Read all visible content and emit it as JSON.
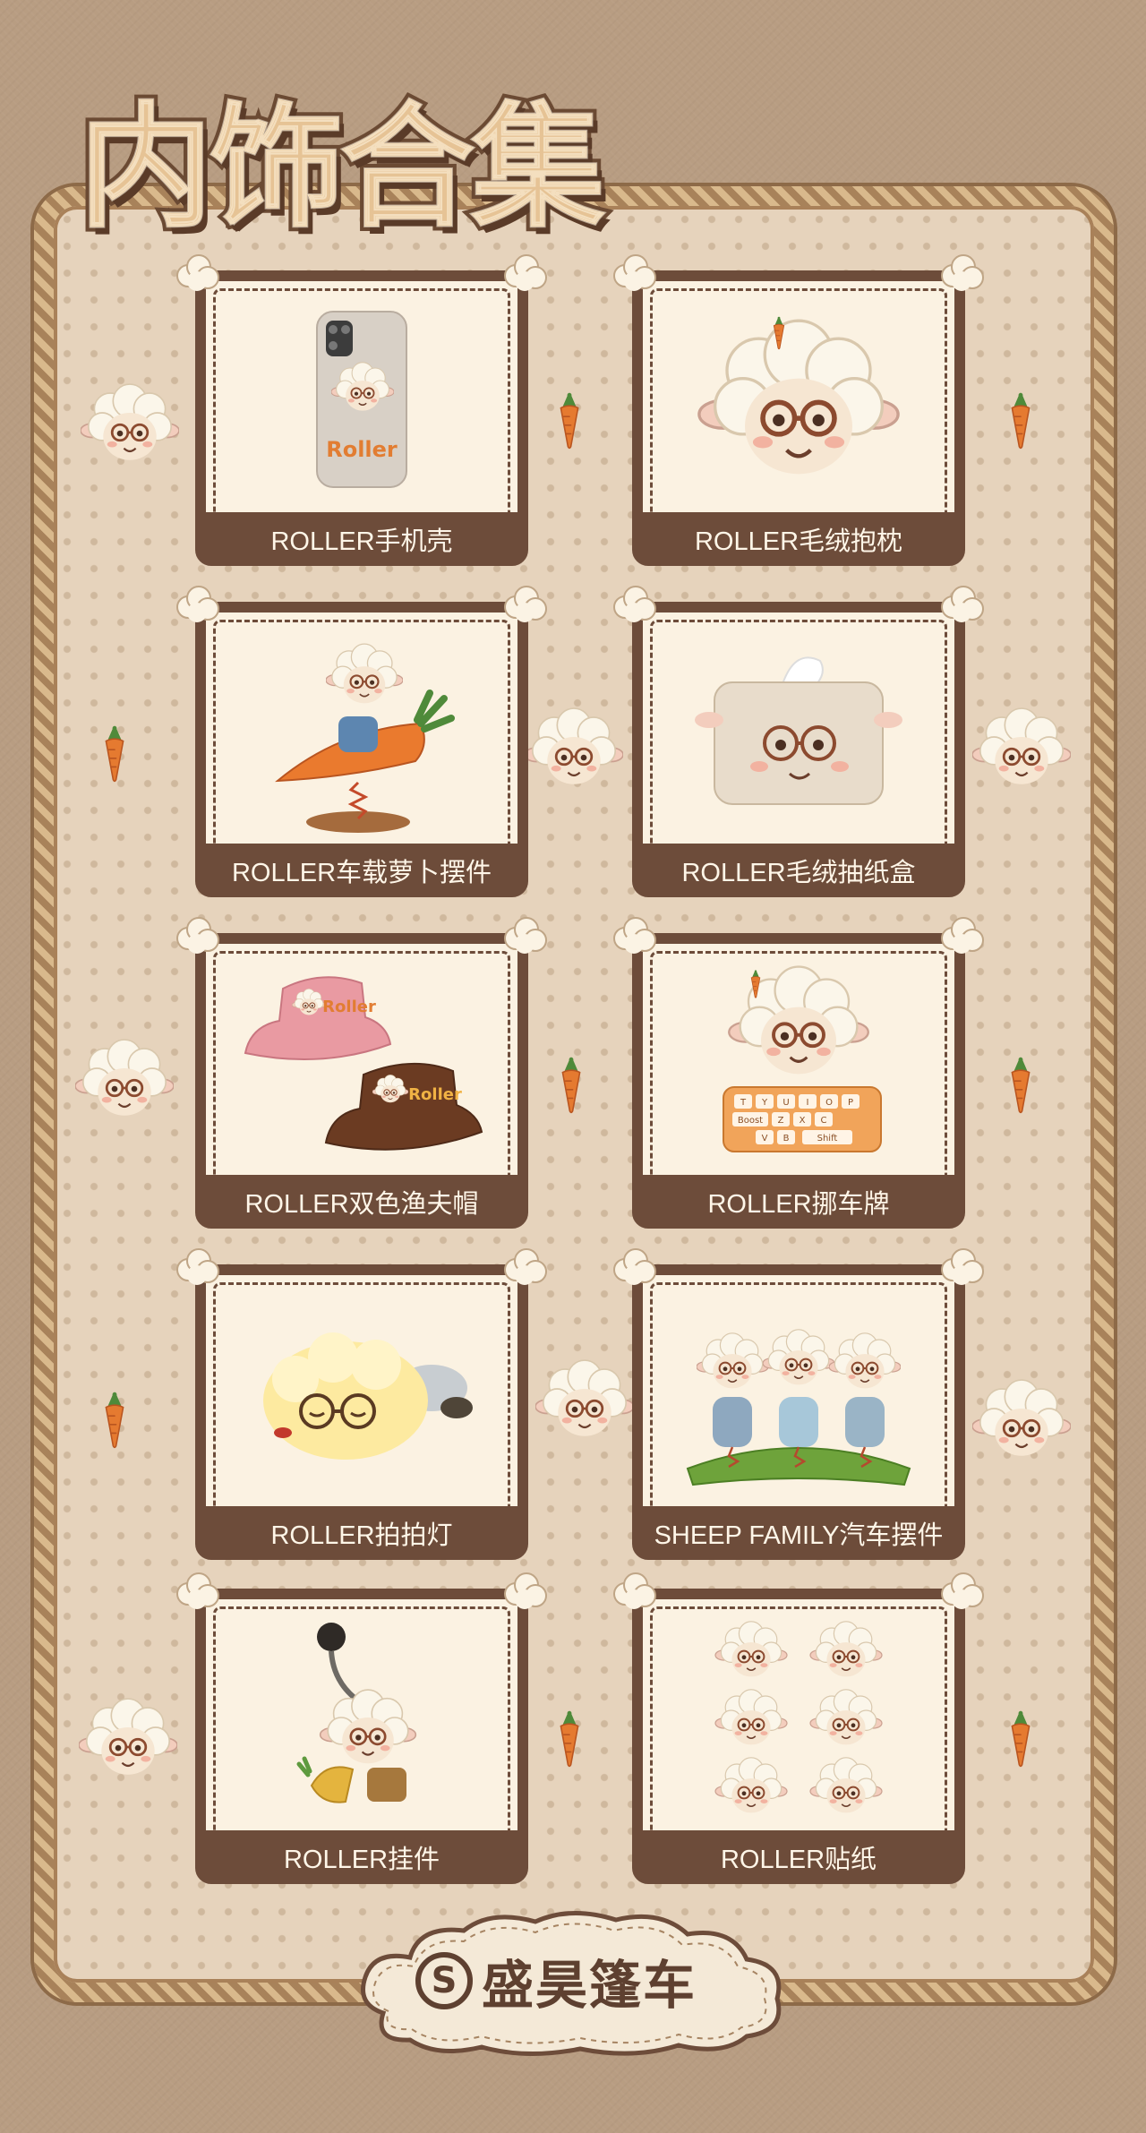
{
  "page": {
    "title": "内饰合集",
    "brand_badge": "S",
    "brand_name": "盛昊篷车"
  },
  "products": [
    {
      "label": "ROLLER手机壳",
      "icon": "phone-case-icon"
    },
    {
      "label": "ROLLER毛绒抱枕",
      "icon": "plush-pillow-icon"
    },
    {
      "label": "ROLLER车载萝卜摆件",
      "icon": "carrot-ornament-icon"
    },
    {
      "label": "ROLLER毛绒抽纸盒",
      "icon": "tissue-box-icon"
    },
    {
      "label": "ROLLER双色渔夫帽",
      "icon": "bucket-hat-icon"
    },
    {
      "label": "ROLLER挪车牌",
      "icon": "parking-sign-icon"
    },
    {
      "label": "ROLLER拍拍灯",
      "icon": "pat-lamp-icon"
    },
    {
      "label": "SHEEP FAMILY汽车摆件",
      "icon": "sheep-family-ornament-icon"
    },
    {
      "label": "ROLLER挂件",
      "icon": "keychain-pendant-icon"
    },
    {
      "label": "ROLLER贴纸",
      "icon": "sticker-sheet-icon"
    }
  ],
  "artwork_text": {
    "phone_case": "Roller",
    "hat_pink": "Roller",
    "hat_brown": "Roller",
    "keyboard_keys": [
      "T",
      "Y",
      "U",
      "I",
      "O",
      "P",
      "Boost",
      "Z",
      "X",
      "C",
      "V",
      "B",
      "Shift"
    ]
  },
  "colors": {
    "background": "#b89d82",
    "panel": "#e6d3bc",
    "card_border": "#6d4c3a",
    "card_fill": "#fbf2e2",
    "label_text": "#fff6e8",
    "title_fill": "#e6c395"
  }
}
